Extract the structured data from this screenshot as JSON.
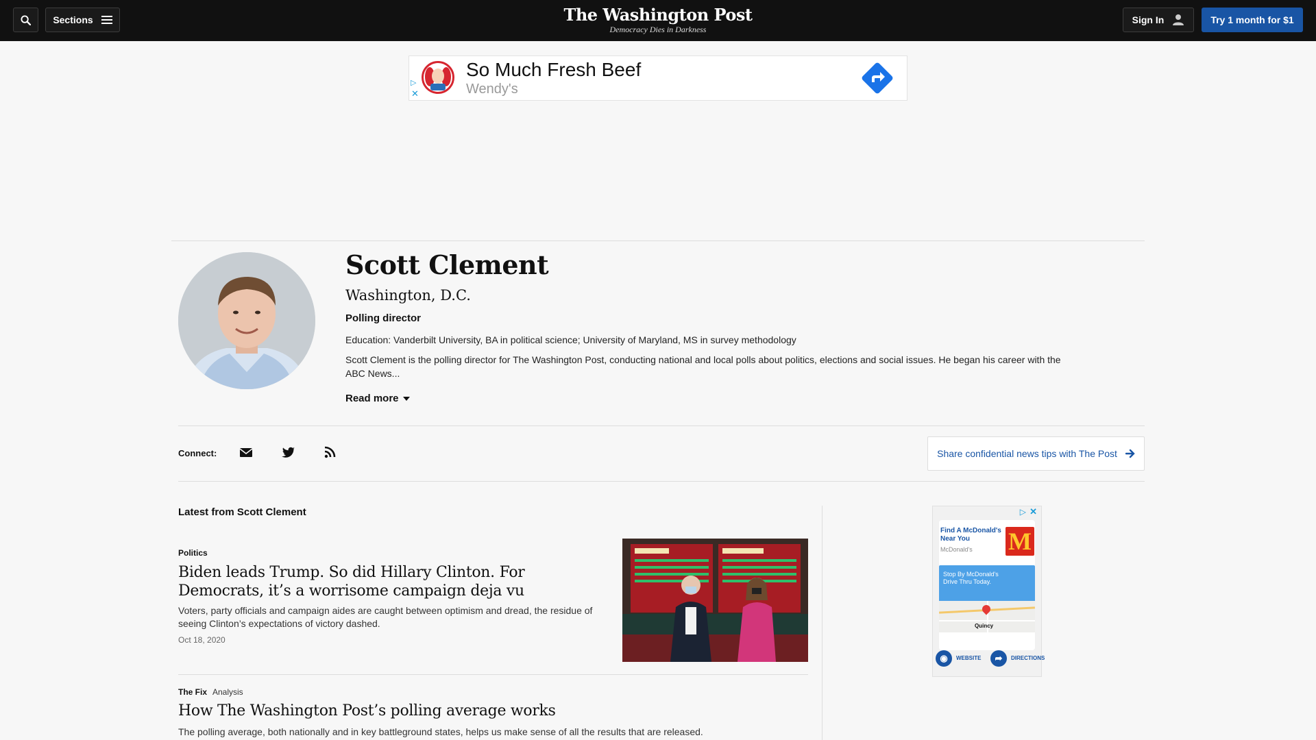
{
  "header": {
    "sections_label": "Sections",
    "logo_title": "The Washington Post",
    "logo_tagline": "Democracy Dies in Darkness",
    "signin_label": "Sign In",
    "trial_label": "Try 1 month for $1"
  },
  "top_ad": {
    "headline": "So Much Fresh Beef",
    "brand": "Wendy's",
    "adchoices_icon": "adchoices-icon",
    "close_icon": "close-icon",
    "arrow_icon": "directions-arrow-icon"
  },
  "author": {
    "name": "Scott Clement",
    "location": "Washington, D.C.",
    "role": "Polling director",
    "education": "Education: Vanderbilt University, BA in political science; University of Maryland, MS in survey methodology",
    "bio": "Scott Clement is the polling director for The Washington Post, conducting national and local polls about politics, elections and social issues. He began his career with the ABC News...",
    "read_more": "Read more"
  },
  "connect": {
    "label": "Connect:",
    "icons": [
      "email-icon",
      "twitter-icon",
      "rss-icon"
    ],
    "tips_label": "Share confidential news tips with The Post"
  },
  "latest": {
    "title": "Latest from Scott Clement",
    "stories": [
      {
        "kicker": "Politics",
        "type": "",
        "headline": "Biden leads Trump. So did Hillary Clinton. For Democrats, it’s a worrisome campaign deja vu",
        "blurb": "Voters, party officials and campaign aides are caught between optimism and dread, the residue of seeing Clinton’s expectations of victory dashed.",
        "date": "Oct 18, 2020"
      },
      {
        "kicker": "The Fix",
        "type": "Analysis",
        "headline": "How The Washington Post’s polling average works",
        "blurb": "The polling average, both nationally and in key battleground states, helps us make sense of all the results that are released.",
        "date": ""
      }
    ]
  },
  "side_ad": {
    "find_text": "Find A McDonald's Near You",
    "brand": "McDonald's",
    "logo_letter": "M",
    "drive_text": "Stop By McDonald's Drive Thru Today.",
    "town": "Quincy",
    "website_label": "WEBSITE",
    "directions_label": "DIRECTIONS"
  },
  "colors": {
    "accent_blue": "#1955a5",
    "nav_bg": "#111111",
    "page_bg": "#f7f7f7",
    "wendys_red": "#d6252f",
    "mcd_red": "#da291c",
    "mcd_yellow": "#ffc72c"
  }
}
